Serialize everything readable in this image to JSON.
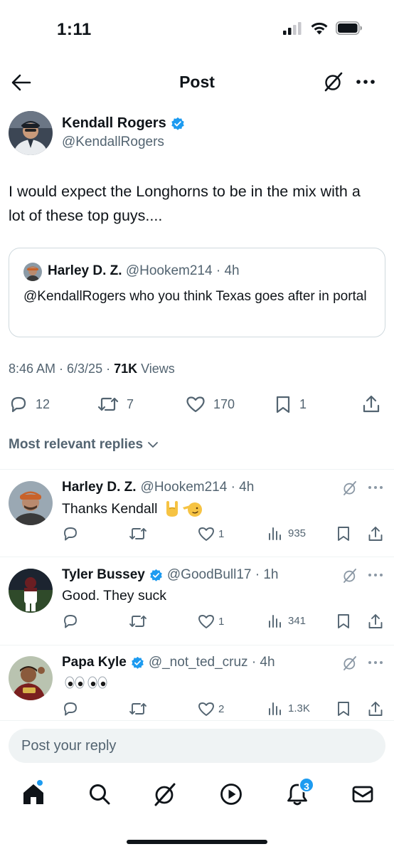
{
  "status_bar": {
    "time": "1:11",
    "icons": [
      "cellular-signal-icon",
      "wifi-icon",
      "battery-icon"
    ]
  },
  "header": {
    "title": "Post",
    "icons": [
      "back-arrow-icon",
      "grok-icon",
      "more-icon"
    ]
  },
  "post": {
    "author_name": "Kendall Rogers",
    "author_handle": "@KendallRogers",
    "verified": true,
    "text": "I would expect the Longhorns to be in the mix with a lot of these top guys....",
    "quote": {
      "name": "Harley D. Z.",
      "handle_time": "@Hookem214 · 4h",
      "text": "@KendallRogers who you think Texas goes after in portal"
    },
    "meta": {
      "datetime": "8:46 AM · 6/3/25 · ",
      "views_count": "71K",
      "views_label": " Views"
    },
    "actions": {
      "replies": "12",
      "reposts": "7",
      "likes": "170",
      "bookmarks": "1"
    }
  },
  "replies_sort": {
    "label": "Most relevant replies"
  },
  "replies": [
    {
      "name": "Harley D. Z.",
      "verified": false,
      "handle_time": "@Hookem214 · 4h",
      "text": "Thanks Kendall",
      "emojis": [
        "sign-of-horns-emoji",
        "saluting-face-emoji"
      ],
      "likes": "1",
      "views": "935"
    },
    {
      "name": "Tyler Bussey",
      "verified": true,
      "handle_time": "@GoodBull17 · 1h",
      "text": "Good. They suck",
      "emojis": [],
      "likes": "1",
      "views": "341"
    },
    {
      "name": "Papa Kyle",
      "verified": true,
      "handle_time": "@_not_ted_cruz · 4h",
      "text": "",
      "emojis": [
        "eyes-emoji",
        "eyes-emoji"
      ],
      "likes": "2",
      "views": "1.3K"
    }
  ],
  "compose": {
    "placeholder": "Post your reply"
  },
  "bottom_nav": {
    "items": [
      "home-icon",
      "search-icon",
      "grok-icon",
      "video-icon",
      "notifications-icon",
      "messages-icon"
    ],
    "notifications_badge": "3"
  },
  "colors": {
    "text": "#0f1419",
    "secondary": "#536471",
    "accent": "#1d9bf0",
    "border": "#cfd9de",
    "compose_bg": "#eff3f4"
  }
}
